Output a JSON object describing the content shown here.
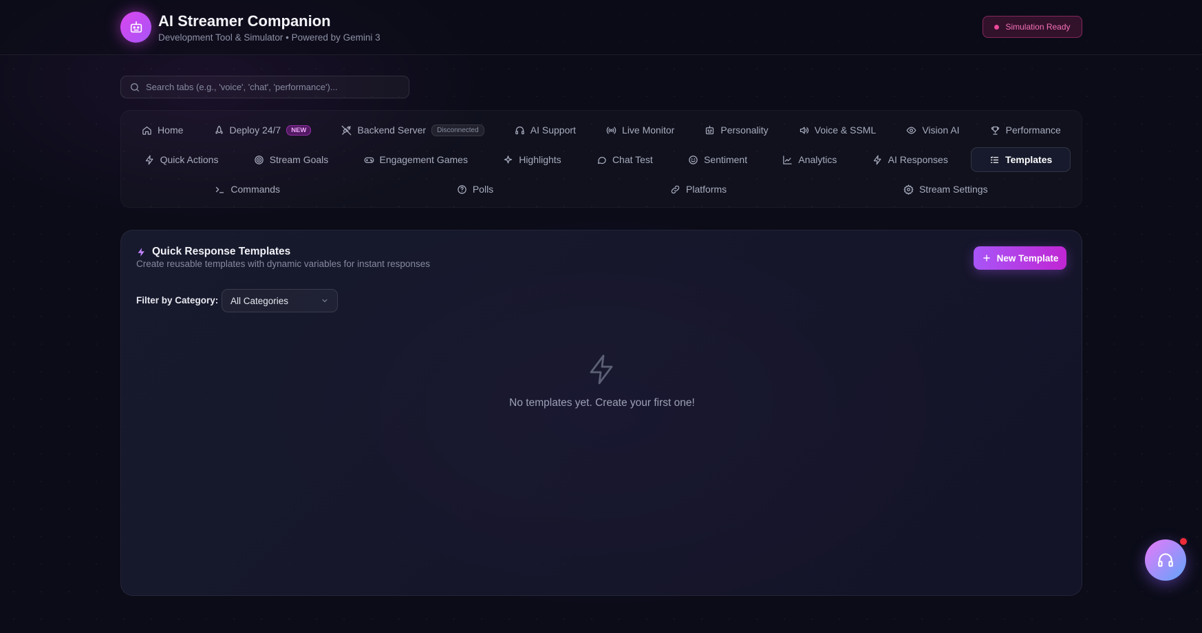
{
  "header": {
    "title": "AI Streamer Companion",
    "subtitle": "Development Tool & Simulator • Powered by Gemini 3",
    "status": "Simulation Ready"
  },
  "search": {
    "placeholder": "Search tabs (e.g., 'voice', 'chat', 'performance')..."
  },
  "tabs": {
    "row1": [
      {
        "label": "Home",
        "icon": "home-icon"
      },
      {
        "label": "Deploy 24/7",
        "icon": "rocket-icon",
        "badge": "NEW"
      },
      {
        "label": "Backend Server",
        "icon": "plug-icon",
        "badge": "Disconnected"
      },
      {
        "label": "AI Support",
        "icon": "headset-icon"
      },
      {
        "label": "Live Monitor",
        "icon": "broadcast-icon"
      },
      {
        "label": "Personality",
        "icon": "robot-icon"
      },
      {
        "label": "Voice & SSML",
        "icon": "speaker-icon"
      },
      {
        "label": "Vision AI",
        "icon": "eye-icon"
      },
      {
        "label": "Performance",
        "icon": "trophy-icon"
      }
    ],
    "row2": [
      {
        "label": "Quick Actions",
        "icon": "bolt-icon"
      },
      {
        "label": "Stream Goals",
        "icon": "target-icon"
      },
      {
        "label": "Engagement Games",
        "icon": "gamepad-icon"
      },
      {
        "label": "Highlights",
        "icon": "sparkle-icon"
      },
      {
        "label": "Chat Test",
        "icon": "chat-bubble-icon"
      },
      {
        "label": "Sentiment",
        "icon": "smile-icon"
      },
      {
        "label": "Analytics",
        "icon": "line-chart-icon"
      },
      {
        "label": "AI Responses",
        "icon": "bolt-icon"
      },
      {
        "label": "Templates",
        "icon": "list-icon",
        "active": true
      }
    ],
    "row3": [
      {
        "label": "Commands",
        "icon": "terminal-icon"
      },
      {
        "label": "Polls",
        "icon": "help-circle-icon"
      },
      {
        "label": "Platforms",
        "icon": "link-icon"
      },
      {
        "label": "Stream Settings",
        "icon": "gear-icon"
      }
    ]
  },
  "panel": {
    "title": "Quick Response Templates",
    "description": "Create reusable templates with dynamic variables for instant responses",
    "new_button": "New Template",
    "filter_label": "Filter by Category:",
    "filter_value": "All Categories",
    "empty_text": "No templates yet. Create your first one!"
  },
  "colors": {
    "accent": "#a855f7",
    "accent_pink": "#ec4899",
    "background": "#0b0c18",
    "notification": "#ef2b3a"
  }
}
